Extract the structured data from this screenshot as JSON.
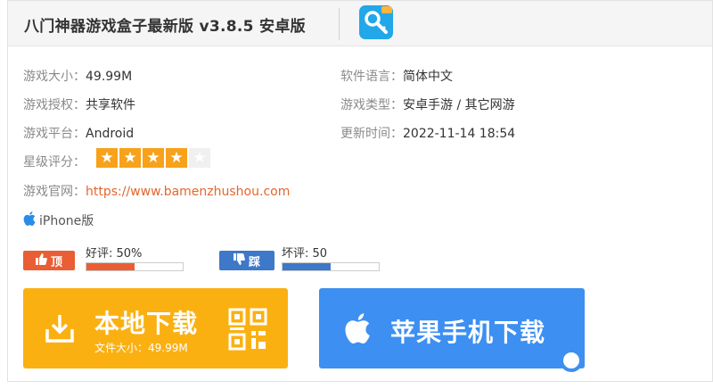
{
  "header": {
    "title": "八门神器游戏盒子最新版 v3.8.5 安卓版"
  },
  "info": {
    "size_label": "游戏大小：",
    "size_value": "49.99M",
    "language_label": "软件语言：",
    "language_value": "简体中文",
    "license_label": "游戏授权：",
    "license_value": "共享软件",
    "type_label": "游戏类型：",
    "type_value": "安卓手游 / 其它网游",
    "platform_label": "游戏平台：",
    "platform_value": "Android",
    "update_label": "更新时间：",
    "update_value": "2022-11-14 18:54",
    "rating_label": "星级评分：",
    "rating_stars": 4,
    "rating_max": 5,
    "website_label": "游戏官网：",
    "website_value": "https://www.bamenzhushou.com",
    "ios_label": "iPhone版"
  },
  "votes": {
    "up_button": "顶",
    "up_text": "好评: 50%",
    "up_fraction": 0.5,
    "up_color": "#e95e34",
    "down_button": "踩",
    "down_text": "坏评: 50",
    "down_fraction": 0.5,
    "down_color": "#3e78c8"
  },
  "download": {
    "local_label": "本地下载",
    "local_size": "文件大小：49.99M",
    "local_color": "#fbb012",
    "apple_label": "苹果手机下载",
    "apple_color": "#3d8ff1",
    "icons": [
      "download-tray-icon",
      "qr-code-icon",
      "apple-icon",
      "thumbs-up-icon",
      "thumbs-down-icon"
    ]
  }
}
